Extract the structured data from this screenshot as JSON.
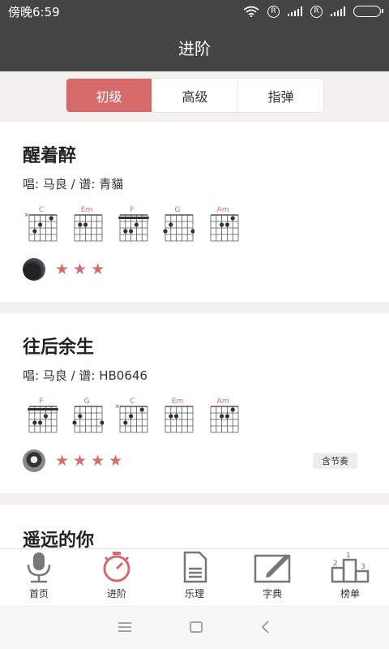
{
  "status_bar": {
    "time": "傍晚6:59",
    "sim1": "R",
    "sim2": "R"
  },
  "header": {
    "title": "进阶"
  },
  "tabs": [
    {
      "label": "初级",
      "active": true
    },
    {
      "label": "高级",
      "active": false
    },
    {
      "label": "指弹",
      "active": false
    }
  ],
  "songs": [
    {
      "title": "醒着醉",
      "meta": "唱: 马良 / 谱: 青貓",
      "chords": [
        "C",
        "Em",
        "F",
        "G",
        "Am"
      ],
      "stars": 3,
      "badge": ""
    },
    {
      "title": "往后余生",
      "meta": "唱: 马良 / 谱: HB0646",
      "chords": [
        "F",
        "G",
        "C",
        "Em",
        "Am"
      ],
      "stars": 4,
      "badge": "含节奏"
    },
    {
      "title": "遥远的你",
      "meta": "",
      "chords": [],
      "stars": 0,
      "badge": ""
    }
  ],
  "bottom_nav": [
    {
      "label": "首页",
      "icon": "microphone-icon",
      "active": false
    },
    {
      "label": "进阶",
      "icon": "stopwatch-icon",
      "active": true
    },
    {
      "label": "乐理",
      "icon": "document-icon",
      "active": false
    },
    {
      "label": "字典",
      "icon": "pencil-board-icon",
      "active": false
    },
    {
      "label": "榜单",
      "icon": "podium-icon",
      "active": false
    }
  ],
  "colors": {
    "accent": "#d66a6a",
    "dark_bar": "#444444",
    "background": "#f2f1ef"
  }
}
